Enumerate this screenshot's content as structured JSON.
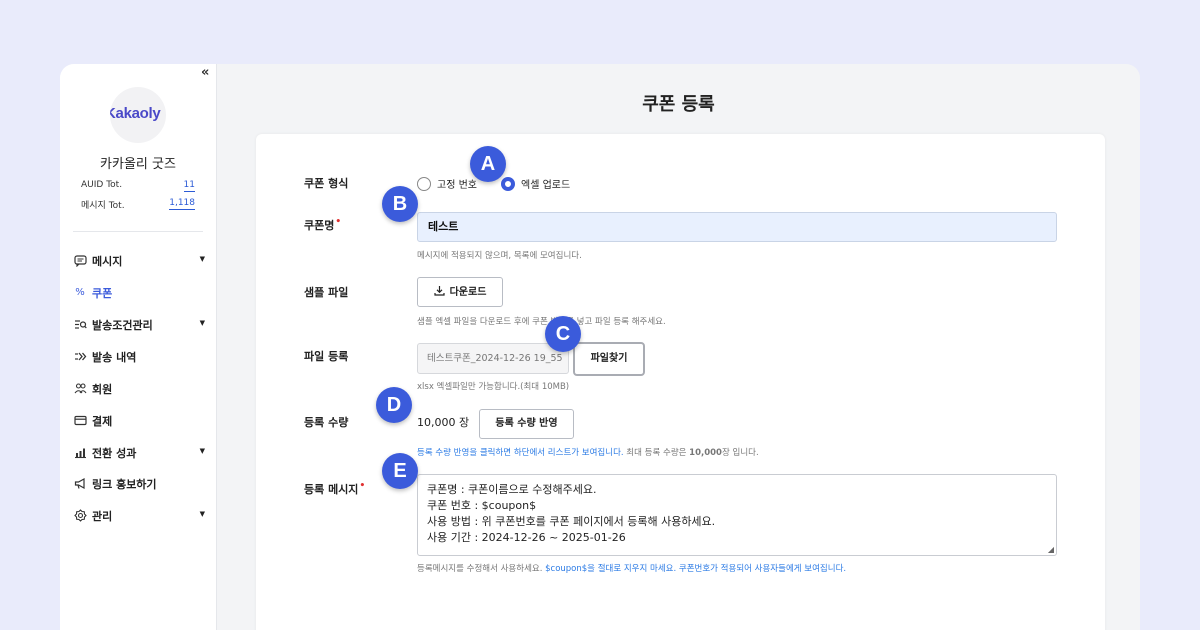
{
  "sidebar": {
    "collapse_icon": "«",
    "logo_text": "Kakaoly",
    "brand_name": "카카올리 굿즈",
    "stats": [
      {
        "label": "AUID Tot.",
        "value": "11"
      },
      {
        "label": "메시지 Tot.",
        "value": "1,118"
      }
    ],
    "items": [
      {
        "label": "메시지",
        "icon": "message-icon",
        "glyph": "▭",
        "caret": true
      },
      {
        "label": "쿠폰",
        "icon": "percent-icon",
        "glyph": "%",
        "caret": false,
        "active": true
      },
      {
        "label": "발송조건관리",
        "icon": "list-search-icon",
        "glyph": "≡",
        "caret": true
      },
      {
        "label": "발송 내역",
        "icon": "send-history-icon",
        "glyph": "≫",
        "caret": false
      },
      {
        "label": "회원",
        "icon": "users-icon",
        "glyph": "☺",
        "caret": false
      },
      {
        "label": "결제",
        "icon": "card-icon",
        "glyph": "▭",
        "caret": false
      },
      {
        "label": "전환 성과",
        "icon": "bar-chart-icon",
        "glyph": "▮",
        "caret": true
      },
      {
        "label": "링크 홍보하기",
        "icon": "megaphone-icon",
        "glyph": "◀",
        "caret": false
      },
      {
        "label": "관리",
        "icon": "gear-icon",
        "glyph": "⚙",
        "caret": true
      }
    ],
    "caret_glyph": "▼"
  },
  "main": {
    "title": "쿠폰 등록"
  },
  "form": {
    "coupon_type_label": "쿠폰 형식",
    "coupon_type_options": [
      {
        "label": "고정 번호",
        "checked": false
      },
      {
        "label": "엑셀 업로드",
        "checked": true
      }
    ],
    "coupon_name_label": "쿠폰명",
    "coupon_name_value": "테스트",
    "coupon_name_help": "메시지에 적용되지 않으며, 목록에 모여집니다.",
    "sample_label": "샘플 파일",
    "download_label": "다운로드",
    "sample_help": "샘플 엑셀 파일을 다운로드 후에 쿠폰 번호를 넣고 파일 등록 해주세요.",
    "file_label": "파일 등록",
    "file_value": "테스트쿠폰_2024-12-26 19_55",
    "find_file_label": "파일찾기",
    "file_help": "xlsx 엑셀파일만 가능합니다.(최대 10MB)",
    "qty_label": "등록 수량",
    "qty_value": "10,000 장",
    "apply_qty_label": "등록 수량 반영",
    "qty_help_blue": "등록 수량 반영을 클릭하면 하단에서 리스트가 보여집니다.",
    "qty_help_rest": " 최대 등록 수량은 ",
    "qty_help_max": "10,000",
    "qty_help_tail": "장 입니다.",
    "message_label": "등록 메시지",
    "message_value": "쿠폰명 : 쿠폰이름으로 수정해주세요.\n쿠폰 번호 : $coupon$\n사용 방법 : 위 쿠폰번호를 쿠폰 페이지에서 등록해 사용하세요.\n사용 기간 : 2024-12-26 ~ 2025-01-26",
    "message_help_grey": "등록메시지를 수정해서 사용하세요. ",
    "message_help_blue": "$coupon$을 절대로 지우지 마세요. 쿠폰번호가 적용되어 사용자들에게 보여집니다."
  },
  "badges": [
    "A",
    "B",
    "C",
    "D",
    "E"
  ],
  "colors": {
    "accent": "#3b5bdb",
    "background": "#e9ebfb",
    "input_fill": "#e8f0fe",
    "required": "#e03131",
    "link_blue": "#2c7be5"
  }
}
